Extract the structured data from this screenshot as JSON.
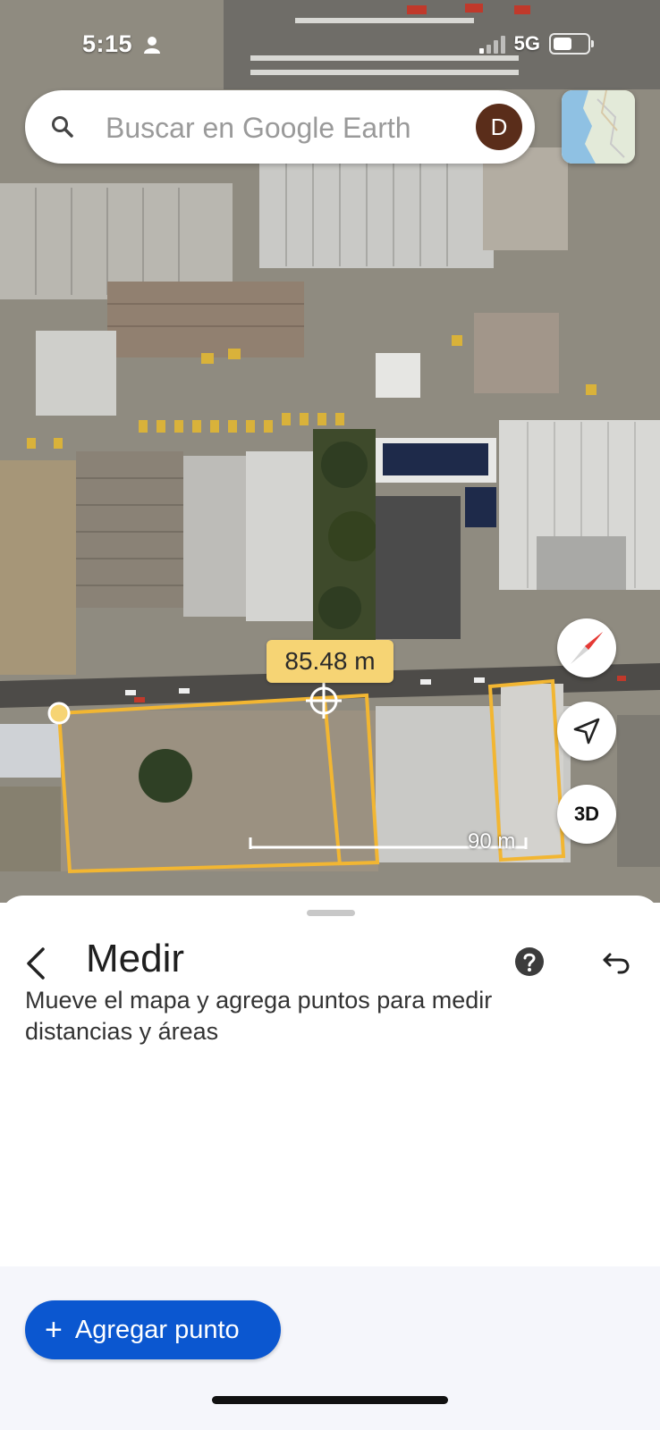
{
  "status_bar": {
    "time": "5:15",
    "network": "5G"
  },
  "search": {
    "placeholder": "Buscar en Google Earth",
    "avatar_initial": "D"
  },
  "map": {
    "measurement_label": "85.48 m",
    "scale_label": "90 m",
    "measure_color": "#f2b632",
    "button_3d_label": "3D",
    "icons": [
      "search-icon",
      "compass-icon",
      "my-location-icon",
      "person-icon"
    ]
  },
  "sheet": {
    "title": "Medir",
    "description": "Mueve el mapa y agrega puntos para medir distancias y áreas",
    "add_point_label": "Agregar punto",
    "accent_color": "#0b57d0",
    "icons": [
      "back-arrow-icon",
      "help-icon",
      "undo-icon",
      "plus-icon"
    ]
  }
}
